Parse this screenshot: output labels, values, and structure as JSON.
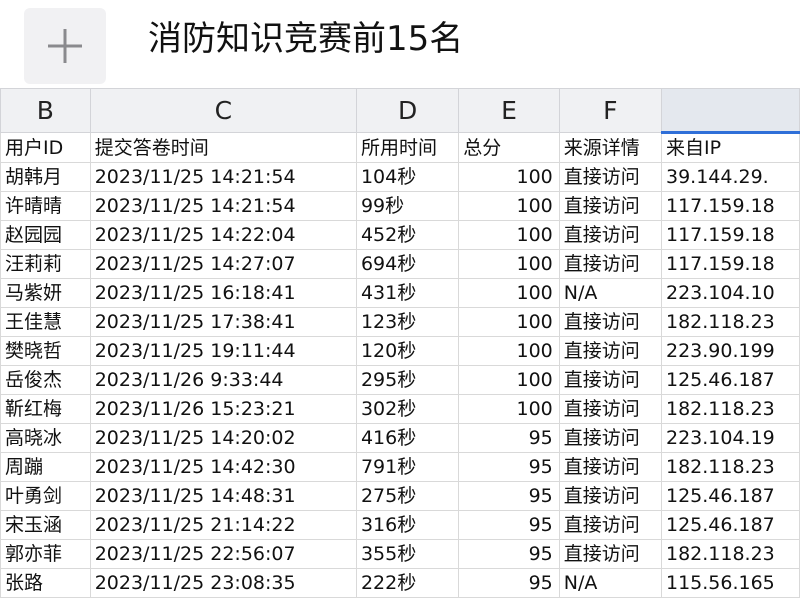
{
  "toolbar": {
    "add_icon": "plus-icon"
  },
  "title": "消防知识竞赛前15名",
  "columns": [
    "B",
    "C",
    "D",
    "E",
    "F",
    ""
  ],
  "headers": [
    "用户ID",
    "提交答卷时间",
    "所用时间",
    "总分",
    "来源详情",
    "来自IP"
  ],
  "rows": [
    [
      "胡韩月",
      "2023/11/25 14:21:54",
      "104秒",
      "100",
      "直接访问",
      "39.144.29."
    ],
    [
      "许晴晴",
      "2023/11/25 14:21:54",
      "99秒",
      "100",
      "直接访问",
      "117.159.18"
    ],
    [
      "赵园园",
      "2023/11/25 14:22:04",
      "452秒",
      "100",
      "直接访问",
      "117.159.18"
    ],
    [
      "汪莉莉",
      "2023/11/25 14:27:07",
      "694秒",
      "100",
      "直接访问",
      "117.159.18"
    ],
    [
      "马紫妍",
      "2023/11/25 16:18:41",
      "431秒",
      "100",
      "N/A",
      "223.104.10"
    ],
    [
      "王佳慧",
      "2023/11/25 17:38:41",
      "123秒",
      "100",
      "直接访问",
      "182.118.23"
    ],
    [
      "樊晓哲",
      "2023/11/25 19:11:44",
      "120秒",
      "100",
      "直接访问",
      "223.90.199"
    ],
    [
      "岳俊杰",
      "2023/11/26 9:33:44",
      "295秒",
      "100",
      "直接访问",
      "125.46.187"
    ],
    [
      "靳红梅",
      "2023/11/26 15:23:21",
      "302秒",
      "100",
      "直接访问",
      "182.118.23"
    ],
    [
      "高晓冰",
      "2023/11/25 14:20:02",
      "416秒",
      "95",
      "直接访问",
      "223.104.19"
    ],
    [
      "周蹦",
      "2023/11/25 14:42:30",
      "791秒",
      "95",
      "直接访问",
      "182.118.23"
    ],
    [
      "叶勇剑",
      "2023/11/25 14:48:31",
      "275秒",
      "95",
      "直接访问",
      "125.46.187"
    ],
    [
      "宋玉涵",
      "2023/11/25 21:14:22",
      "316秒",
      "95",
      "直接访问",
      "125.46.187"
    ],
    [
      "郭亦菲",
      "2023/11/25 22:56:07",
      "355秒",
      "95",
      "直接访问",
      "182.118.23"
    ],
    [
      "张路",
      "2023/11/25 23:08:35",
      "222秒",
      "95",
      "N/A",
      "115.56.165"
    ]
  ],
  "colors": {
    "accent": "#2f6fd8",
    "header_bg": "#f0f1f3"
  }
}
